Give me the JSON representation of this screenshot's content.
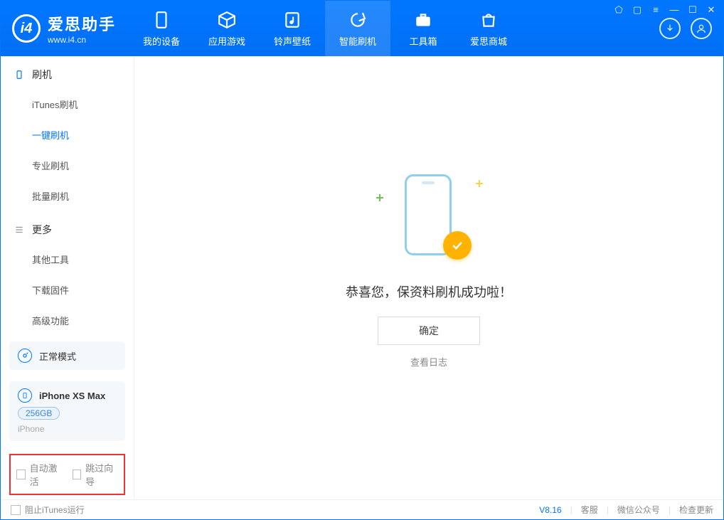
{
  "app": {
    "title": "爱思助手",
    "subtitle": "www.i4.cn"
  },
  "header_tabs": {
    "device": "我的设备",
    "apps": "应用游戏",
    "ringtone": "铃声壁纸",
    "flash": "智能刷机",
    "toolbox": "工具箱",
    "store": "爱思商城"
  },
  "sidebar": {
    "section_flash": "刷机",
    "items_flash": {
      "itunes": "iTunes刷机",
      "oneclick": "一键刷机",
      "pro": "专业刷机",
      "batch": "批量刷机"
    },
    "section_more": "更多",
    "items_more": {
      "other_tools": "其他工具",
      "download_fw": "下载固件",
      "advanced": "高级功能"
    }
  },
  "side_panels": {
    "mode": "正常模式",
    "device_name": "iPhone XS Max",
    "storage": "256GB",
    "device_type": "iPhone"
  },
  "options": {
    "auto_activate": "自动激活",
    "skip_guide": "跳过向导"
  },
  "main": {
    "success_msg": "恭喜您，保资料刷机成功啦！",
    "ok_button": "确定",
    "view_log": "查看日志"
  },
  "footer": {
    "block_itunes": "阻止iTunes运行",
    "version": "V8.16",
    "support": "客服",
    "wechat": "微信公众号",
    "check_update": "检查更新"
  }
}
